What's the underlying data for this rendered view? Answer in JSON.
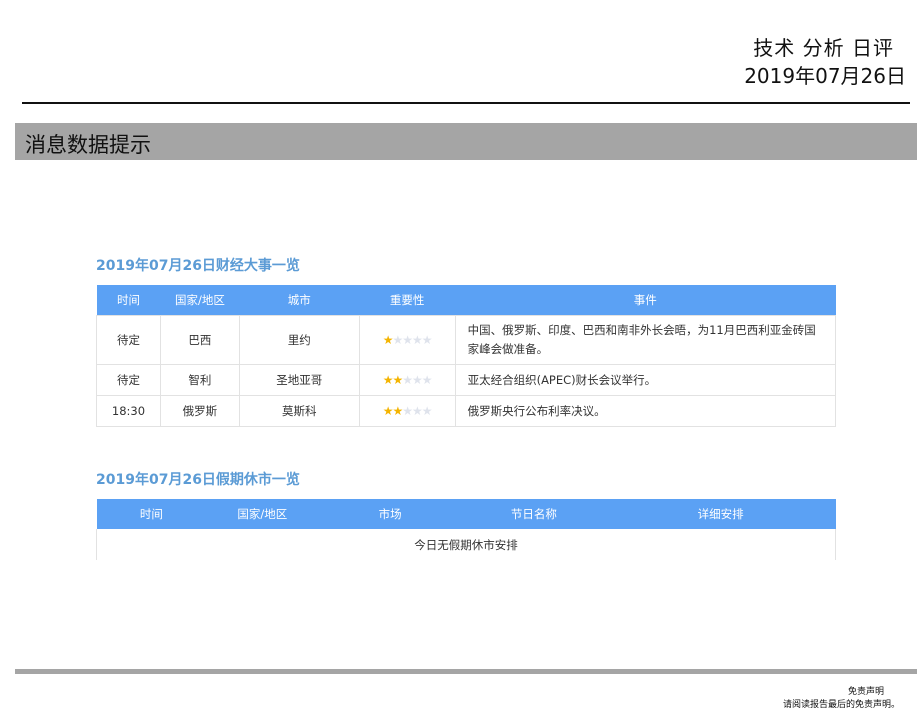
{
  "header": {
    "title": "技术 分析 日评",
    "date": "2019年07月26日"
  },
  "section": {
    "title": "消息数据提示"
  },
  "events_table": {
    "caption": "2019年07月26日财经大事一览",
    "columns": [
      "时间",
      "国家/地区",
      "城市",
      "重要性",
      "事件"
    ],
    "rows": [
      {
        "time": "待定",
        "country": "巴西",
        "city": "里约",
        "importance": 1,
        "event": "中国、俄罗斯、印度、巴西和南非外长会晤，为11月巴西利亚金砖国家峰会做准备。"
      },
      {
        "time": "待定",
        "country": "智利",
        "city": "圣地亚哥",
        "importance": 2,
        "event": "亚太经合组织(APEC)财长会议举行。"
      },
      {
        "time": "18:30",
        "country": "俄罗斯",
        "city": "莫斯科",
        "importance": 2,
        "event": "俄罗斯央行公布利率决议。"
      }
    ],
    "max_importance": 5
  },
  "holiday_table": {
    "caption": "2019年07月26日假期休市一览",
    "columns": [
      "时间",
      "国家/地区",
      "市场",
      "节日名称",
      "详细安排"
    ],
    "empty_message": "今日无假期休市安排"
  },
  "footer": {
    "disclaimer_title": "免责声明",
    "disclaimer_text": "请阅读报告最后的免责声明。"
  },
  "colors": {
    "accent": "#5ba1f4",
    "caption": "#5b9bd5",
    "section_bar": "#a5a5a5",
    "star_on": "#f4b400",
    "star_off": "#dfe3ec"
  }
}
